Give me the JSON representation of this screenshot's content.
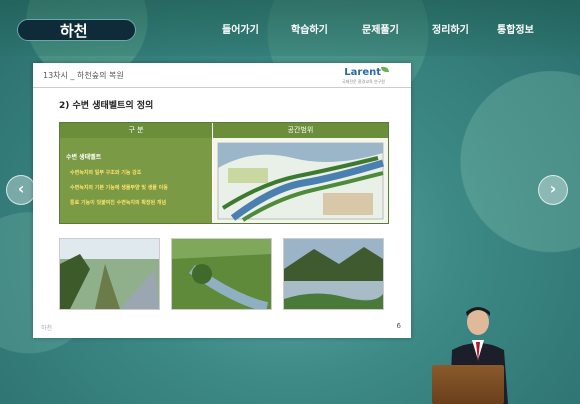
{
  "header": {
    "logo_text": "하천",
    "nav": [
      "들어가기",
      "학습하기",
      "문제풀기",
      "정리하기",
      "통합정보"
    ]
  },
  "slide": {
    "lesson_title": "13차시 _ 하천숲의 복원",
    "brand": "Larent",
    "brand_sub": "국제전문 환경교육 연구원",
    "heading": "2) 수변 생태벨트의 정의",
    "table": {
      "col1": "구  분",
      "col2": "공간범위",
      "bullet": "수변 생태벨트",
      "items": [
        "수변녹지의 일부 구조와 기능 강조",
        "수변녹지의 기본 기능에 생물부양 및 생물 이동",
        "통로 기능이 덧붙여진 수변녹지의 확장된 개념"
      ]
    },
    "footer_left": "하천",
    "page_number": "6"
  },
  "nav_arrows": {
    "prev": "‹",
    "next": "›"
  }
}
